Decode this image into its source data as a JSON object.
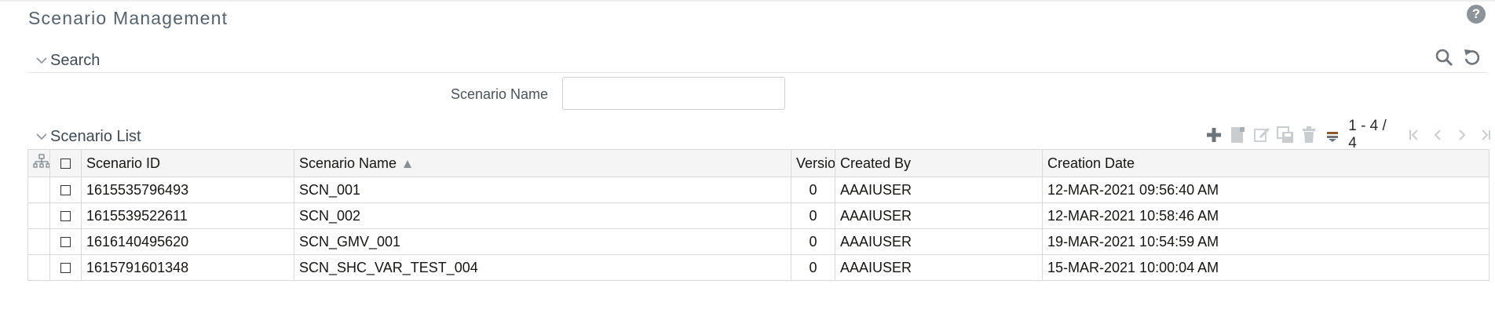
{
  "page": {
    "title": "Scenario Management"
  },
  "search_section": {
    "label": "Search",
    "field_label": "Scenario Name",
    "field_value": "",
    "field_placeholder": "",
    "icons": [
      "search-icon",
      "reset-icon"
    ]
  },
  "list_section": {
    "label": "Scenario List",
    "toolbar_icons": [
      "add-icon",
      "copy-icon",
      "edit-icon",
      "save-as-icon",
      "delete-icon",
      "records-per-page-icon"
    ],
    "pager_text": "1 - 4 / 4",
    "pager_icons": [
      "first-page-icon",
      "previous-page-icon",
      "next-page-icon",
      "last-page-icon"
    ],
    "columns": [
      "Scenario ID",
      "Scenario Name",
      "Version",
      "Created By",
      "Creation Date"
    ],
    "sorted_column": "Scenario Name",
    "sort_direction": "ascending",
    "rows": [
      {
        "id": "1615535796493",
        "name": "SCN_001",
        "version": "0",
        "created_by": "AAAIUSER",
        "created_on": "12-MAR-2021 09:56:40 AM"
      },
      {
        "id": "1615539522611",
        "name": "SCN_002",
        "version": "0",
        "created_by": "AAAIUSER",
        "created_on": "12-MAR-2021 10:58:46 AM"
      },
      {
        "id": "1616140495620",
        "name": "SCN_GMV_001",
        "version": "0",
        "created_by": "AAAIUSER",
        "created_on": "19-MAR-2021 10:54:59 AM"
      },
      {
        "id": "1615791601348",
        "name": "SCN_SHC_VAR_TEST_004",
        "version": "0",
        "created_by": "AAAIUSER",
        "created_on": "15-MAR-2021 10:00:04 AM"
      }
    ]
  },
  "colors": {
    "title": "#55626c",
    "header_bg": "#f5f5f5",
    "border": "#d9d9d9",
    "icon_gray": "#8c9399"
  }
}
